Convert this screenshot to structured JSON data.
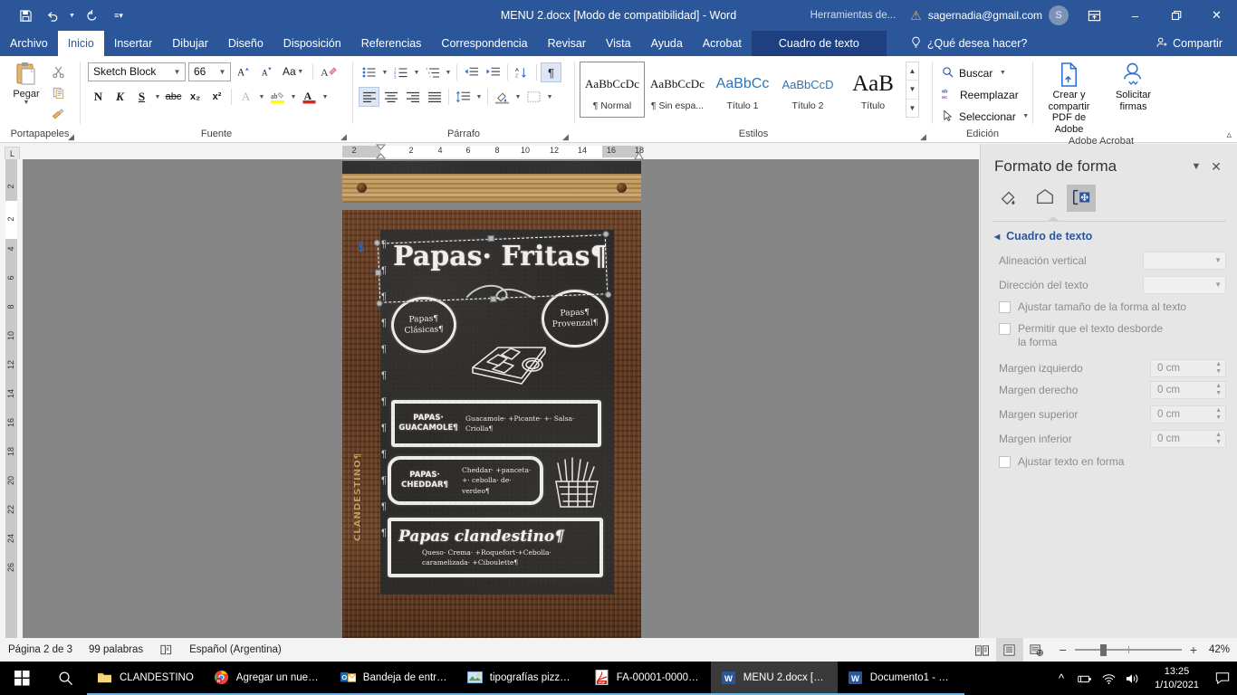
{
  "titlebar": {
    "document_title": "MENU 2.docx [Modo de compatibilidad]  -  Word",
    "quick_access": [
      "save-icon",
      "undo-icon",
      "redo-icon",
      "customize-qat-icon"
    ],
    "context_tools_label": "Herramientas de...",
    "account_email": "sagernadia@gmail.com",
    "account_initial": "S",
    "ribbon_display_icon": "ribbon-display-options-icon",
    "minimize": "–",
    "restore": "❑",
    "close": "✕"
  },
  "tabs": [
    {
      "label": "Archivo",
      "active": false
    },
    {
      "label": "Inicio",
      "active": true
    },
    {
      "label": "Insertar",
      "active": false
    },
    {
      "label": "Dibujar",
      "active": false
    },
    {
      "label": "Diseño",
      "active": false
    },
    {
      "label": "Disposición",
      "active": false
    },
    {
      "label": "Referencias",
      "active": false
    },
    {
      "label": "Correspondencia",
      "active": false
    },
    {
      "label": "Revisar",
      "active": false
    },
    {
      "label": "Vista",
      "active": false
    },
    {
      "label": "Ayuda",
      "active": false
    },
    {
      "label": "Acrobat",
      "active": false
    }
  ],
  "contextual_tab": "Cuadro de texto",
  "tell_me": {
    "label": "¿Qué desea hacer?",
    "icon": "lightbulb-icon"
  },
  "share": {
    "label": "Compartir",
    "icon": "share-person-icon"
  },
  "ribbon": {
    "clipboard": {
      "group_label": "Portapapeles",
      "paste_label": "Pegar",
      "cut": "cut-scissors-icon",
      "copy": "copy-icon",
      "format_painter": "format-painter-icon"
    },
    "font": {
      "group_label": "Fuente",
      "font_name": "Sketch Block",
      "font_size": "66",
      "grow_font": "grow-font-icon",
      "shrink_font": "shrink-font-icon",
      "change_case": "Aa",
      "clear_format": "clear-formatting-icon",
      "bold": "N",
      "italic": "K",
      "underline": "S",
      "strikethrough": "abc",
      "subscript": "x₂",
      "superscript": "x²",
      "text_effects": "A",
      "highlight": "ab",
      "font_color": "A"
    },
    "paragraph": {
      "group_label": "Párrafo",
      "bullets": "bullets-icon",
      "numbering": "numbering-icon",
      "multilevel": "multilevel-list-icon",
      "decrease_indent": "decrease-indent-icon",
      "increase_indent": "increase-indent-icon",
      "sort": "sort-icon",
      "show_marks": "show-paragraph-marks-icon",
      "align_left": "align-left-icon",
      "align_center": "align-center-icon",
      "align_right": "align-right-icon",
      "justify": "justify-icon",
      "line_spacing": "line-spacing-icon",
      "shading": "shading-icon",
      "borders": "borders-icon"
    },
    "styles": {
      "group_label": "Estilos",
      "items": [
        {
          "preview": "AaBbCcDc",
          "name": "¶ Normal",
          "selected": true
        },
        {
          "preview": "AaBbCcDc",
          "name": "¶ Sin espa...",
          "selected": false
        },
        {
          "preview": "AaBbCc",
          "name": "Título 1",
          "selected": false
        },
        {
          "preview": "AaBbCcD",
          "name": "Título 2",
          "selected": false
        },
        {
          "preview": "AaB",
          "name": "Título",
          "selected": false
        }
      ]
    },
    "editing": {
      "group_label": "Edición",
      "find": "Buscar",
      "replace": "Reemplazar",
      "select": "Seleccionar"
    },
    "acrobat": {
      "group_label": "Adobe Acrobat",
      "create_pdf": "Crear y compartir PDF de Adobe",
      "request_signatures": "Solicitar firmas"
    }
  },
  "ruler": {
    "tab_stop_marker": "L",
    "horizontal_ticks": [
      "2",
      "2",
      "4",
      "6",
      "8",
      "10",
      "12",
      "14",
      "16",
      "18"
    ],
    "vertical_ticks": [
      "2",
      "2",
      "4",
      "6",
      "8",
      "10",
      "12",
      "14",
      "16",
      "18",
      "20",
      "22",
      "24",
      "26"
    ]
  },
  "document": {
    "menu": {
      "title": "Papas· Fritas¶",
      "circle_left": [
        "Papas¶",
        "Clásicas¶"
      ],
      "circle_right": [
        "Papas¶",
        "Provenzal¶"
      ],
      "items": [
        {
          "name": "PAPAS· GUACAMOLE¶",
          "description": "Guacamole· +Picante· +· Salsa· Criolla¶"
        },
        {
          "name": "PAPAS· CHEDDAR¶",
          "description": "Cheddar· +panceta· +· cebolla· de· verdeo¶"
        },
        {
          "name": "Papas clandestino¶",
          "description": "Queso· Crema· +Roquefort·+Cebolla· caramelizada· +Ciboulette¶"
        }
      ],
      "side_brand": "CLANDESTINO¶"
    }
  },
  "pane": {
    "title": "Formato de forma",
    "dropdown_icon": "chevron-down-icon",
    "close_icon": "close-icon",
    "tabs": [
      {
        "icon": "fill-line-icon",
        "active": false
      },
      {
        "icon": "effects-pentagon-icon",
        "active": false
      },
      {
        "icon": "layout-properties-icon",
        "active": true
      }
    ],
    "section_title": "Cuadro de texto",
    "fields": [
      {
        "label": "Alineación vertical",
        "underline_at": 12,
        "type": "combo",
        "value": ""
      },
      {
        "label": "Dirección del texto",
        "underline_at": 14,
        "type": "combo",
        "value": ""
      }
    ],
    "checkboxes_top": [
      {
        "label": "Ajustar tamaño de la forma al texto",
        "checked": false
      },
      {
        "label": "Permitir que el texto desborde la forma",
        "checked": false
      }
    ],
    "margins": [
      {
        "label": "Margen izquierdo",
        "value": "0 cm"
      },
      {
        "label": "Margen derecho",
        "value": "0 cm"
      },
      {
        "label": "Margen superior",
        "value": "0 cm"
      },
      {
        "label": "Margen inferior",
        "value": "0 cm"
      }
    ],
    "checkbox_bottom": {
      "label": "Ajustar texto en forma",
      "checked": false
    }
  },
  "status": {
    "page": "Página 2 de 3",
    "words": "99 palabras",
    "proofing_icon": "proofing-errors-icon",
    "language": "Español (Argentina)",
    "views": [
      {
        "icon": "read-mode-icon",
        "active": false
      },
      {
        "icon": "print-layout-icon",
        "active": true
      },
      {
        "icon": "web-layout-icon",
        "active": false
      }
    ],
    "zoom_out": "−",
    "zoom_in": "+",
    "zoom_level": "42%"
  },
  "taskbar": {
    "start_icon": "windows-start-icon",
    "search_icon": "search-icon",
    "apps": [
      {
        "label": "CLANDESTINO",
        "icon": "folder-icon",
        "state": "open"
      },
      {
        "label": "Agregar un nuev...",
        "icon": "chrome-icon",
        "state": "open"
      },
      {
        "label": "Bandeja de entra...",
        "icon": "outlook-icon",
        "state": "open"
      },
      {
        "label": "tipografías pizzar...",
        "icon": "photos-icon",
        "state": "open"
      },
      {
        "label": "FA-00001-000005...",
        "icon": "pdf-icon",
        "state": "open"
      },
      {
        "label": "MENU 2.docx [M...",
        "icon": "word-icon",
        "state": "active"
      },
      {
        "label": "Documento1 - W...",
        "icon": "word-icon",
        "state": "open"
      }
    ],
    "tray": [
      "show-hidden-icons-chevron",
      "battery-icon",
      "wifi-icon",
      "volume-icon"
    ],
    "clock_time": "13:25",
    "clock_date": "1/10/2021",
    "action_center_icon": "action-center-icon"
  },
  "colors": {
    "word_blue": "#2b579a",
    "accent_link": "#2b579a",
    "pane_bg": "#e6e6e6",
    "chalk_board": "#2e2c2a",
    "wood_dark": "#5a3219",
    "wood_light": "#b98f4f"
  }
}
